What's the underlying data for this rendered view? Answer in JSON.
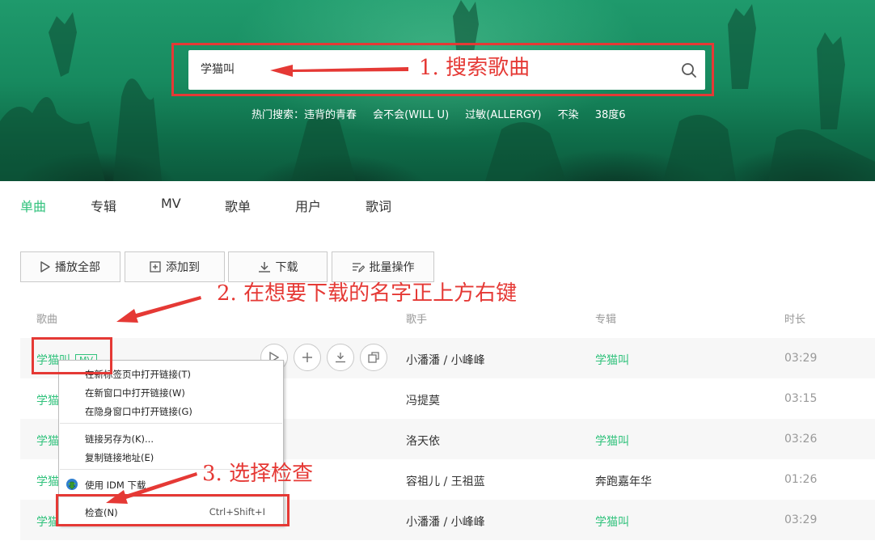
{
  "search": {
    "value": "学猫叫",
    "hot_label": "热门搜索：",
    "hot_keywords": [
      "违背的青春",
      "会不会(WILL U)",
      "过敏(ALLERGY)",
      "不染",
      "38度6"
    ]
  },
  "annotations": {
    "step1": "1.  搜索歌曲",
    "step2": "2.  在想要下载的名字正上方右键",
    "step3": "3.  选择检查"
  },
  "tabs": [
    "单曲",
    "专辑",
    "MV",
    "歌单",
    "用户",
    "歌词"
  ],
  "active_tab": "单曲",
  "toolbar": {
    "play_all": "播放全部",
    "add_to": "添加到",
    "download": "下载",
    "batch": "批量操作"
  },
  "table": {
    "headers": {
      "song": "歌曲",
      "singer": "歌手",
      "album": "专辑",
      "duration": "时长"
    },
    "rows": [
      {
        "song": "学猫叫",
        "mv": "MV",
        "singer": "小潘潘 / 小峰峰",
        "album": "学猫叫",
        "duration": "03:29"
      },
      {
        "song": "学猫",
        "mv": "",
        "singer": "冯提莫",
        "album": "",
        "duration": "03:15"
      },
      {
        "song": "学猫",
        "mv": "",
        "singer": "洛天依",
        "album": "学猫叫",
        "duration": "03:26"
      },
      {
        "song": "学猫",
        "mv": "",
        "singer": "容祖儿 / 王祖蓝",
        "album": "奔跑嘉年华",
        "duration": "01:26"
      },
      {
        "song": "学猫",
        "mv": "",
        "singer": "小潘潘 / 小峰峰",
        "album": "学猫叫",
        "duration": "03:29"
      }
    ]
  },
  "context_menu": {
    "items": [
      {
        "label": "在新标签页中打开链接(T)",
        "shortcut": ""
      },
      {
        "label": "在新窗口中打开链接(W)",
        "shortcut": ""
      },
      {
        "label": "在隐身窗口中打开链接(G)",
        "shortcut": ""
      },
      {
        "label": "链接另存为(K)...",
        "shortcut": ""
      },
      {
        "label": "复制链接地址(E)",
        "shortcut": ""
      },
      {
        "label": "使用 IDM 下载",
        "shortcut": "",
        "icon": "idm-icon"
      },
      {
        "label": "检查(N)",
        "shortcut": "Ctrl+Shift+I"
      }
    ]
  },
  "colors": {
    "accent": "#31c27c",
    "annotation": "#e53935",
    "banner": "#178a5f"
  }
}
